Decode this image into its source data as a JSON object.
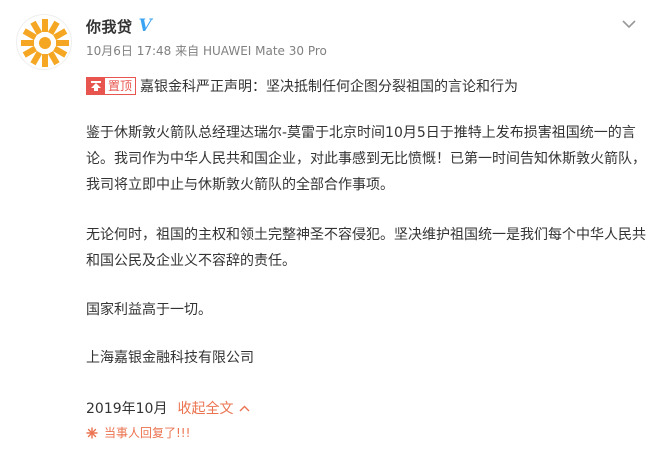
{
  "post": {
    "author": {
      "name": "你我贷",
      "verified_mark": "V",
      "avatar_icon": "sunburst-logo-icon"
    },
    "meta": {
      "date": "10月6日 17:48",
      "source_prefix": "来自",
      "device": "HUAWEI Mate 30 Pro"
    },
    "pinned_label": "置顶",
    "headline": "嘉银金科严正声明：坚决抵制任何企图分裂祖国的言论和行为",
    "paragraphs": [
      "鉴于休斯敦火箭队总经理达瑞尔-莫雷于北京时间10月5日于推特上发布损害祖国统一的言论。我司作为中华人民共和国企业，对此事感到无比愤慨！已第一时间告知休斯敦火箭队，我司将立即中止与休斯敦火箭队的全部合作事项。",
      "无论何时，祖国的主权和领土完整神圣不容侵犯。坚决维护祖国统一是我们每个中华人民共和国公民及企业义不容辞的责任。",
      "国家利益高于一切。",
      "上海嘉银金融科技有限公司"
    ],
    "footer": {
      "time": "2019年10月",
      "collapse_label": "收起全文",
      "reply_notice": "当事人回复了!!!"
    },
    "colors": {
      "accent": "#eb7350",
      "verified": "#3ba3f3",
      "pin": "#e8544e",
      "logo": "#f5a623"
    }
  }
}
